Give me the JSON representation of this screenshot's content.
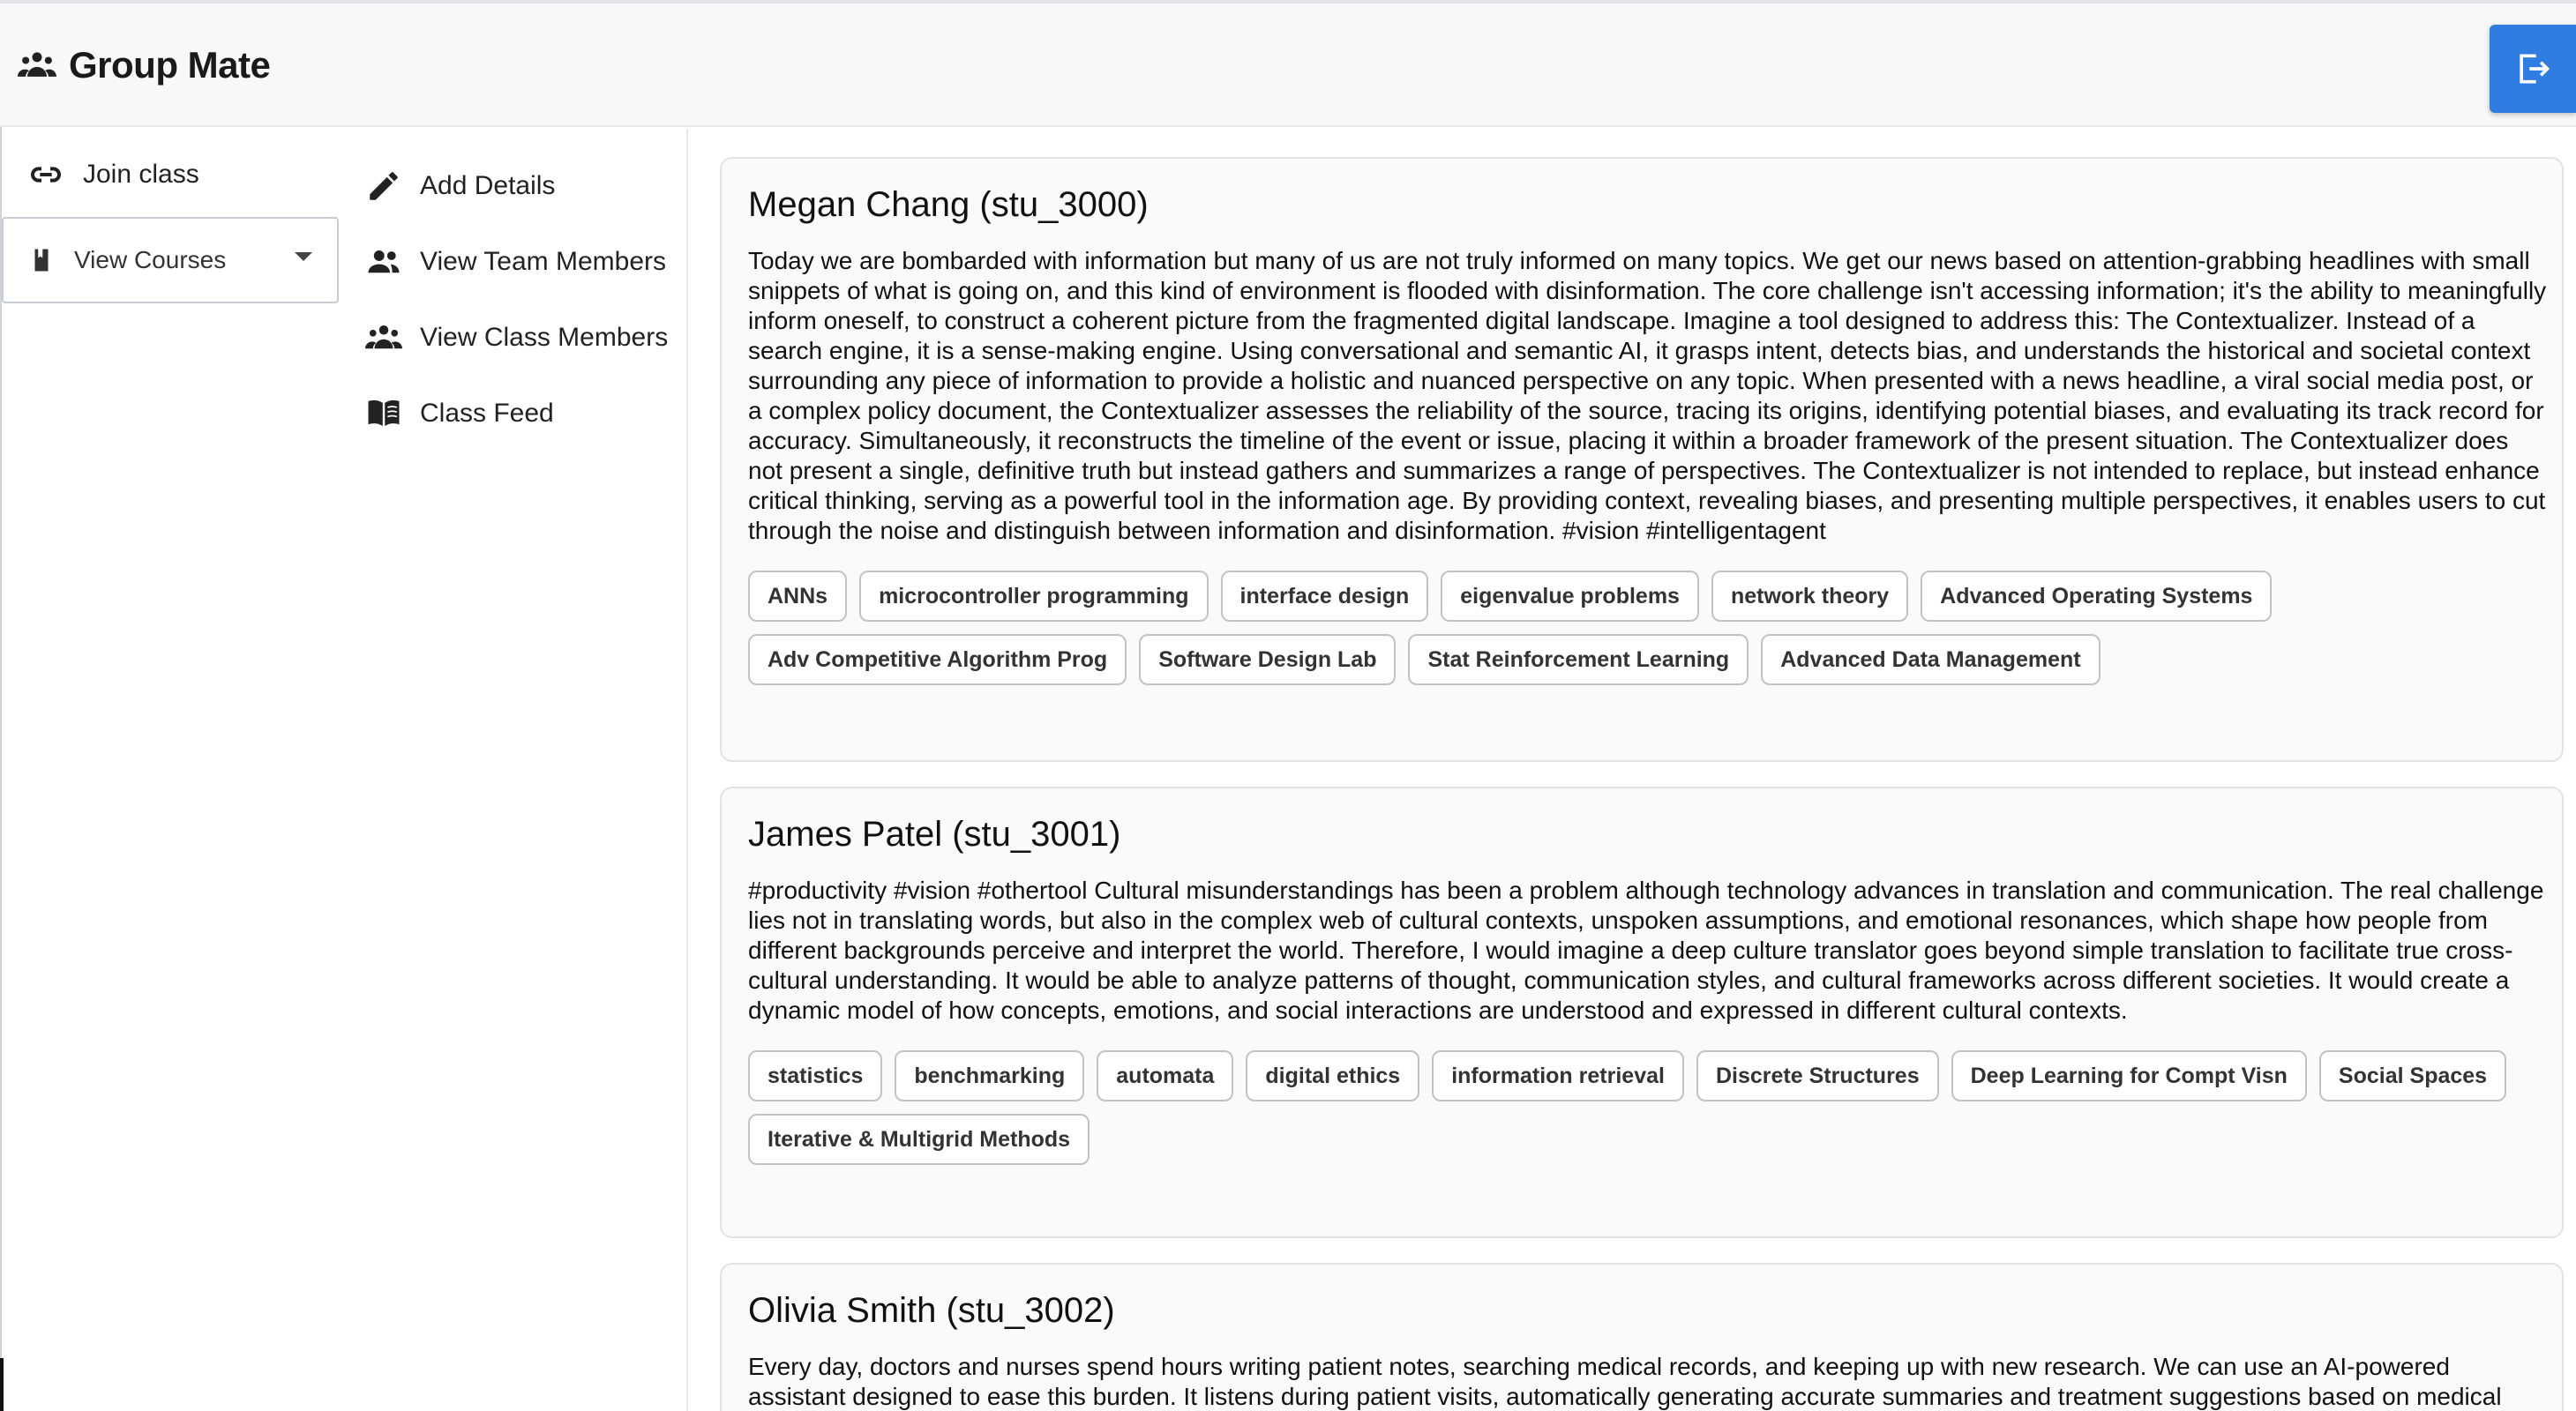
{
  "header": {
    "title": "Group Mate",
    "icon": "group-icon",
    "logout_icon": "logout-icon",
    "accent": "#2f7de1"
  },
  "sidebar": {
    "join_class": "Join class",
    "view_courses": "View Courses"
  },
  "nav": {
    "items": [
      {
        "label": "Add Details",
        "icon": "pencil-icon"
      },
      {
        "label": "View Team Members",
        "icon": "team-icon"
      },
      {
        "label": "View Class Members",
        "icon": "class-group-icon"
      },
      {
        "label": "Class Feed",
        "icon": "book-open-icon"
      }
    ]
  },
  "posts": [
    {
      "title": "Megan Chang (stu_3000)",
      "text": "Today we are bombarded with information but many of us are not truly informed on many topics. We get our news based on attention-grabbing headlines with small snippets of what is going on, and this kind of environment is flooded with disinformation. The core challenge isn't accessing information; it's the ability to meaningfully inform oneself, to construct a coherent picture from the fragmented digital landscape. Imagine a tool designed to address this: The Contextualizer. Instead of a search engine, it is a sense-making engine. Using conversational and semantic AI, it grasps intent, detects bias, and understands the historical and societal context surrounding any piece of information to provide a holistic and nuanced perspective on any topic. When presented with a news headline, a viral social media post, or a complex policy document, the Contextualizer assesses the reliability of the source, tracing its origins, identifying potential biases, and evaluating its track record for accuracy. Simultaneously, it reconstructs the timeline of the event or issue, placing it within a broader framework of the present situation. The Contextualizer does not present a single, definitive truth but instead gathers and summarizes a range of perspectives. The Contextualizer is not intended to replace, but instead enhance critical thinking, serving as a powerful tool in the information age. By providing context, revealing biases, and presenting multiple perspectives, it enables users to cut through the noise and distinguish between information and disinformation. #vision #intelligentagent",
      "tags": [
        "ANNs",
        "microcontroller programming",
        "interface design",
        "eigenvalue problems",
        "network theory",
        "Advanced Operating Systems",
        "Adv Competitive Algorithm Prog",
        "Software Design Lab",
        "Stat Reinforcement Learning",
        "Advanced Data Management"
      ]
    },
    {
      "title": "James Patel (stu_3001)",
      "text": "#productivity #vision #othertool Cultural misunderstandings has been a problem although technology advances in translation and communication. The real challenge lies not in translating words, but also in the complex web of cultural contexts, unspoken assumptions, and emotional resonances, which shape how people from different backgrounds perceive and interpret the world. Therefore, I would imagine a deep culture translator goes beyond simple translation to facilitate true cross-cultural understanding. It would be able to analyze patterns of thought, communication styles, and cultural frameworks across different societies. It would create a dynamic model of how concepts, emotions, and social interactions are understood and expressed in different cultural contexts.",
      "tags": [
        "statistics",
        "benchmarking",
        "automata",
        "digital ethics",
        "information retrieval",
        "Discrete Structures",
        "Deep Learning for Compt Visn",
        "Social Spaces",
        "Iterative & Multigrid Methods"
      ]
    },
    {
      "title": "Olivia Smith (stu_3002)",
      "text": "Every day, doctors and nurses spend hours writing patient notes, searching medical records, and keeping up with new research. We can use an AI-powered assistant designed to ease this burden. It listens during patient visits, automatically generating accurate summaries and treatment suggestions based on medical history and the latest guidelines. Instead of spending late nights on paperwork, doctors can focus on patient care. It also highlights important research",
      "tags": []
    }
  ]
}
